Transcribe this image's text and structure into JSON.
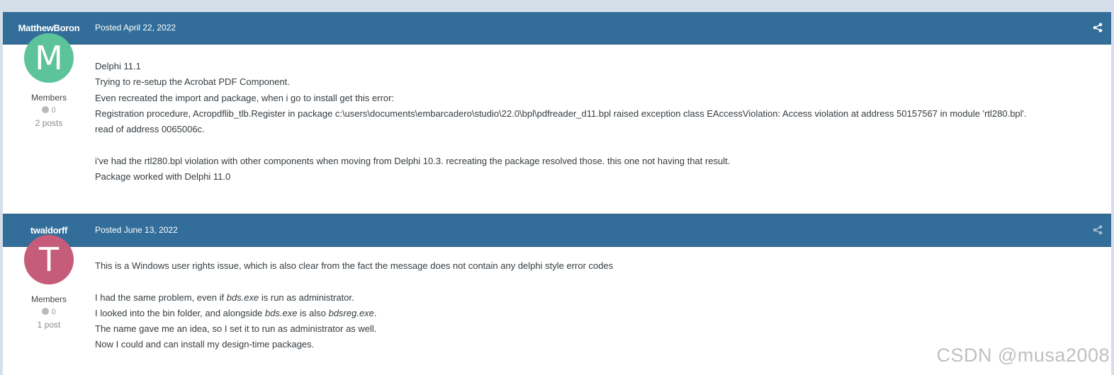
{
  "colors": {
    "header_bg": "#336e9a",
    "page_bg": "#d4dfe9",
    "avatar_m": "#5cc39b",
    "avatar_t": "#c45c7a"
  },
  "posts": [
    {
      "author": "MatthewBoron",
      "date": "Posted April 22, 2022",
      "avatar_letter": "M",
      "group": "Members",
      "reputation": "0",
      "post_count": "2 posts",
      "lines": [
        "Delphi 11.1",
        "Trying to re-setup the Acrobat PDF Component.",
        "Even recreated the import and package, when i go to install get this error:",
        "Registration procedure, Acropdflib_tlb.Register in package c:\\users\\documents\\embarcadero\\studio\\22.0\\bpl\\pdfreader_d11.bpl raised exception class EAccessViolation: Access violation at address 50157567 in module 'rtl280.bpl'.",
        "read of address 0065006c.",
        "",
        "i've had the rtl280.bpl violation with other components when moving from Delphi 10.3.  recreating the package resolved those.  this one not having that result.",
        "Package worked with Delphi 11.0"
      ]
    },
    {
      "author": "twaldorff",
      "date": "Posted June 13, 2022",
      "avatar_letter": "T",
      "group": "Members",
      "reputation": "0",
      "post_count": "1 post",
      "line1": "This is a Windows user rights issue, which is also clear from the fact the message does not contain any delphi style error codes",
      "line2_a": "I had the same problem, even if ",
      "line2_em": "bds.exe",
      "line2_b": " is run as administrator.",
      "line3_a": "I looked into the bin folder, and alongside ",
      "line3_em1": "bds.exe",
      "line3_b": " is also ",
      "line3_em2": "bdsreg.exe",
      "line3_c": ".",
      "line4": "The name gave me an idea, so I set it to run as administrator as well.",
      "line5": "Now I could and can install my design-time packages."
    }
  ],
  "icons": {
    "share": "share-icon"
  },
  "watermark": "CSDN @musa2008"
}
